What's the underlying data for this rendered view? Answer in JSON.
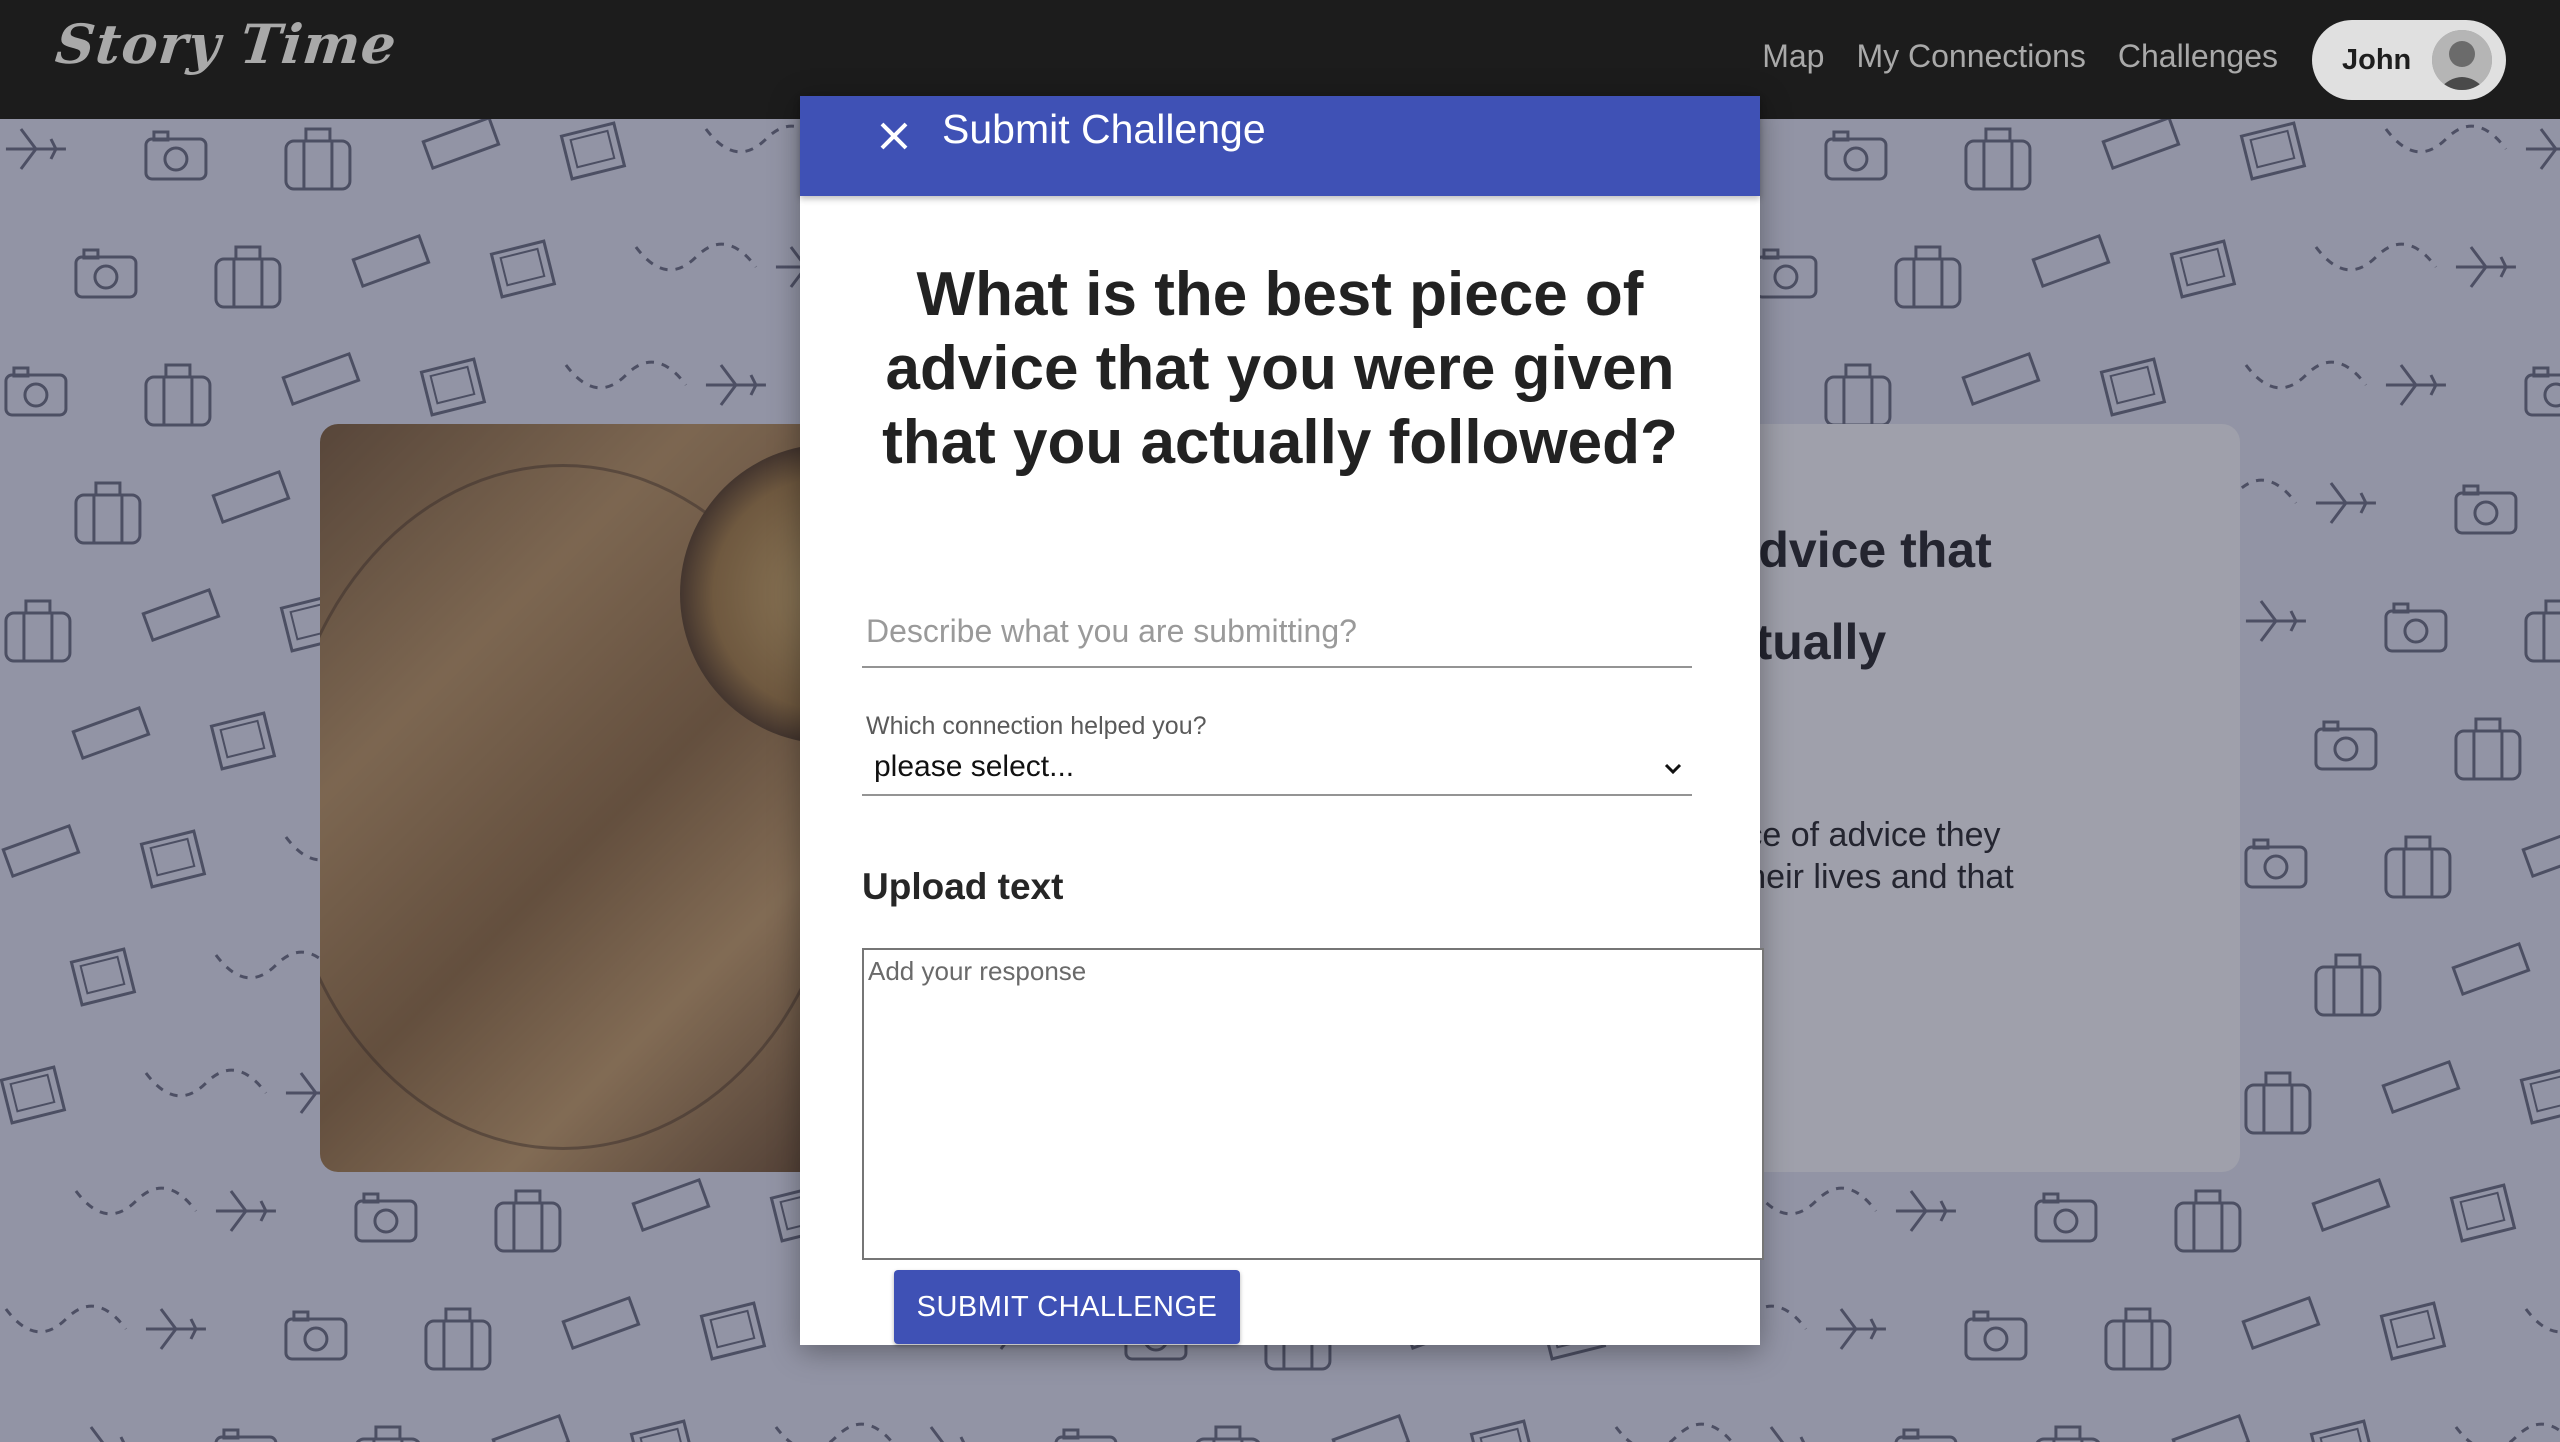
{
  "navbar": {
    "logo": "Story Time",
    "links": [
      "Map",
      "My Connections",
      "Challenges"
    ],
    "user_name": "John"
  },
  "background_card": {
    "title_partial": "f advice that\nactually",
    "description_partial": "piece of advice they\nto their lives and that"
  },
  "modal": {
    "header_title": "Submit Challenge",
    "question": "What is the best piece of advice that you were given that you actually followed?",
    "describe_placeholder": "Describe what you are submitting?",
    "connection_label": "Which connection helped you?",
    "connection_selected": "please select...",
    "upload_heading": "Upload text",
    "response_placeholder": "Add your response",
    "submit_label": "SUBMIT CHALLENGE"
  },
  "icons": {
    "close": "close-icon",
    "chevron": "chevron-down-icon",
    "avatar": "avatar"
  },
  "colors": {
    "primary": "#3f51b5",
    "navbar": "#1c1c1c",
    "pill": "#e0e0e0"
  }
}
